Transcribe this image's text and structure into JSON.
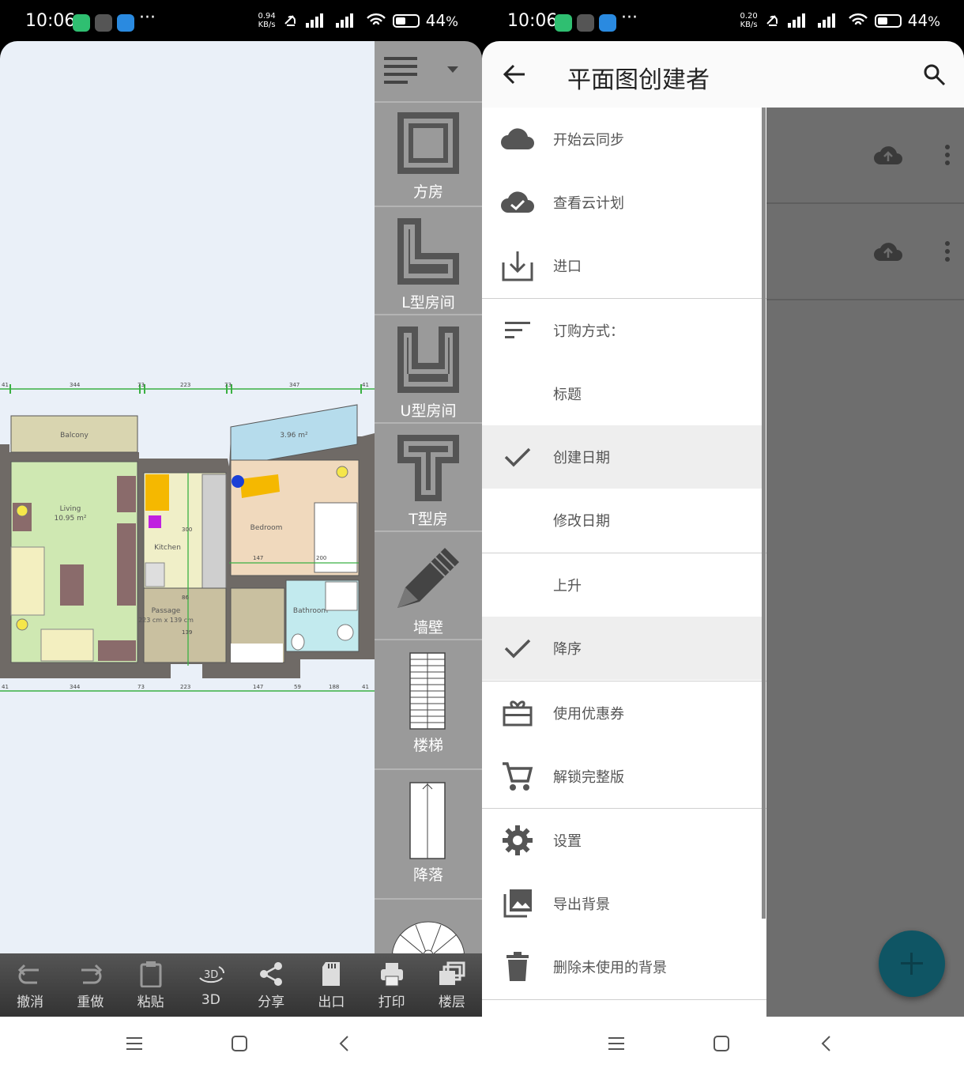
{
  "left": {
    "status": {
      "time": "10:06",
      "speed": "0.94",
      "speed_unit": "KB/s",
      "battery": "44",
      "battery_unit": "%"
    },
    "plan": {
      "rooms": {
        "balcony": "Balcony",
        "living": "Living",
        "living_area": "10.95 m²",
        "kitchen": "Kitchen",
        "bedroom": "Bedroom",
        "bathroom": "Bathroom",
        "passage": "Passage",
        "passage_size": "223 cm x 139 cm",
        "terrace_area": "3.96 m²"
      },
      "dims_top": [
        "41",
        "344",
        "73",
        "223",
        "73",
        "347",
        "41"
      ],
      "dims_bottom": [
        "41",
        "344",
        "73",
        "223",
        "147",
        "59",
        "188",
        "41"
      ],
      "dims_inner": {
        "kitchen_h": "300",
        "bed_w": "147",
        "bed_h": "200",
        "passage_h": "139",
        "passage_x": "86"
      }
    },
    "tools": [
      {
        "label": "方房",
        "icon": "square-room-icon"
      },
      {
        "label": "L型房间",
        "icon": "l-room-icon"
      },
      {
        "label": "U型房间",
        "icon": "u-room-icon"
      },
      {
        "label": "T型房",
        "icon": "t-room-icon"
      },
      {
        "label": "墙壁",
        "icon": "pencil-icon"
      },
      {
        "label": "楼梯",
        "icon": "stairs-icon"
      },
      {
        "label": "降落",
        "icon": "landing-icon"
      }
    ],
    "bottombar": [
      {
        "label": "撤消",
        "icon": "undo-icon"
      },
      {
        "label": "重做",
        "icon": "redo-icon"
      },
      {
        "label": "粘贴",
        "icon": "paste-icon"
      },
      {
        "label": "3D",
        "icon": "3d-icon",
        "glyph": "3D"
      },
      {
        "label": "分享",
        "icon": "share-icon"
      },
      {
        "label": "出口",
        "icon": "sdcard-icon"
      },
      {
        "label": "打印",
        "icon": "print-icon"
      },
      {
        "label": "楼层",
        "icon": "layers-icon"
      }
    ]
  },
  "right": {
    "status": {
      "time": "10:06",
      "speed": "0.20",
      "speed_unit": "KB/s",
      "battery": "44",
      "battery_unit": "%"
    },
    "appbar": {
      "title": "平面图创建者"
    },
    "drawer": [
      {
        "label": "开始云同步",
        "icon": "cloud-icon"
      },
      {
        "label": "查看云计划",
        "icon": "cloud-check-icon"
      },
      {
        "label": "进口",
        "icon": "import-icon"
      },
      {
        "label": "订购方式：",
        "icon": "sort-icon"
      },
      {
        "label": "标题",
        "icon": ""
      },
      {
        "label": "创建日期",
        "icon": "check-icon",
        "selected": true
      },
      {
        "label": "修改日期",
        "icon": ""
      },
      {
        "label": "上升",
        "icon": ""
      },
      {
        "label": "降序",
        "icon": "check-icon",
        "selected": true
      },
      {
        "label": "使用优惠券",
        "icon": "coupon-icon"
      },
      {
        "label": "解锁完整版",
        "icon": "cart-icon"
      },
      {
        "label": "设置",
        "icon": "gear-icon"
      },
      {
        "label": "导出背景",
        "icon": "image-icon"
      },
      {
        "label": "删除未使用的背景",
        "icon": "trash-icon"
      }
    ]
  }
}
